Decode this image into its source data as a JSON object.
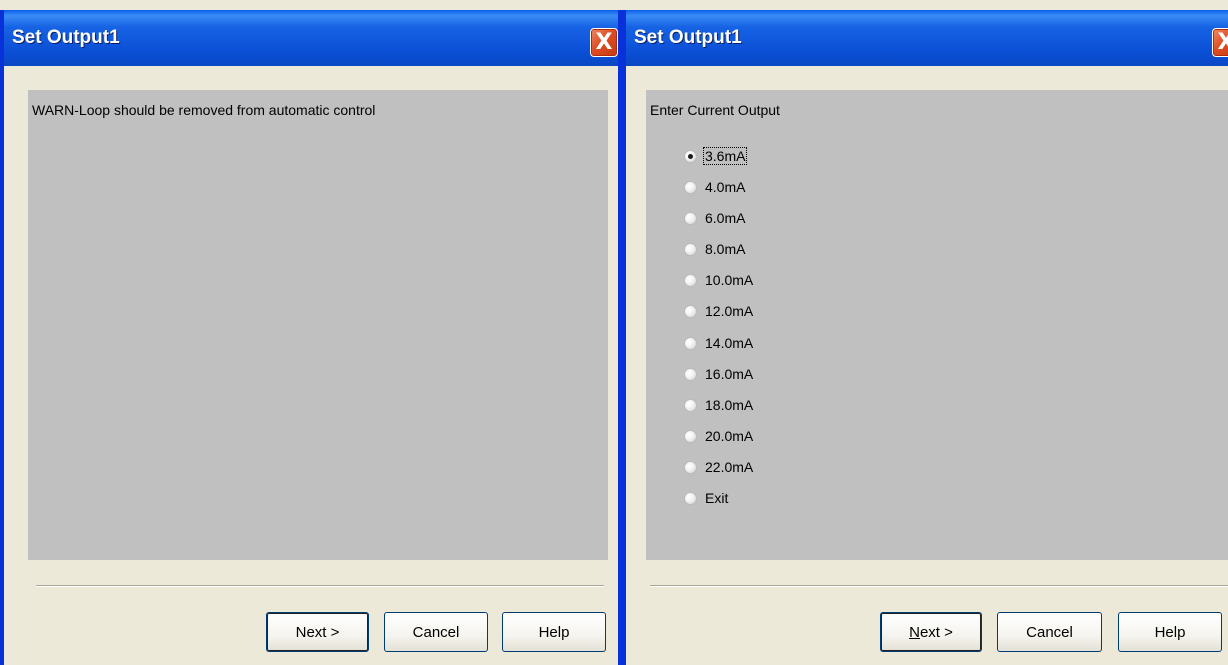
{
  "dialogs": [
    {
      "title": "Set Output1",
      "close_label": "X",
      "message": "WARN-Loop should be removed from automatic control",
      "buttons": {
        "next": "Next >",
        "cancel": "Cancel",
        "help": "Help"
      }
    },
    {
      "title": "Set Output1",
      "close_label": "X",
      "message": "Enter Current Output",
      "options": [
        "3.6mA",
        "4.0mA",
        "6.0mA",
        "8.0mA",
        "10.0mA",
        "12.0mA",
        "14.0mA",
        "16.0mA",
        "18.0mA",
        "20.0mA",
        "22.0mA",
        "Exit"
      ],
      "selected_option": "3.6mA",
      "buttons": {
        "next_mnemonic": "N",
        "next_rest": "ext >",
        "cancel": "Cancel",
        "help": "Help"
      }
    }
  ],
  "colors": {
    "titlebar": "#0a5ee8",
    "close_button": "#de4d24",
    "content_bg": "#c0c0c0",
    "window_bg": "#ece9d8"
  }
}
